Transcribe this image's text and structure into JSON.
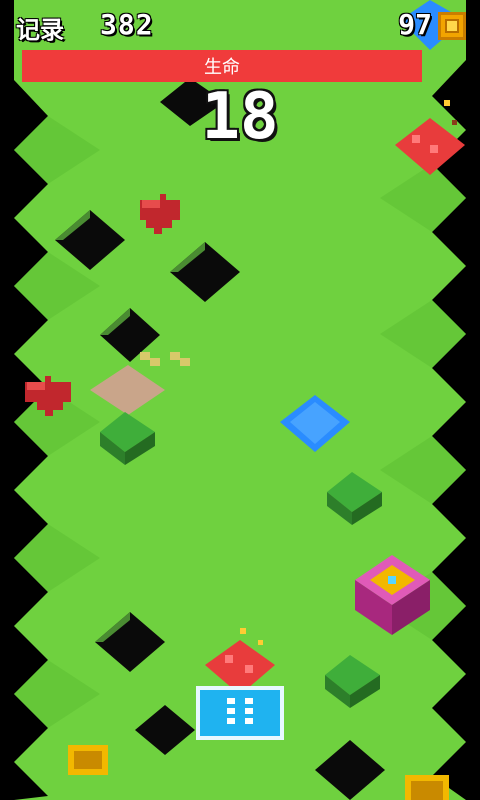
{
  "hud": {
    "record_label": "记录",
    "record_value": "382",
    "coins": "97",
    "coin_icon": "coin-icon",
    "life_label": "生命",
    "score": "18"
  },
  "controls": {
    "pause_icon": "pause-icon"
  },
  "colors": {
    "grass": "#6fd13f",
    "grass_dark": "#5cbf33",
    "side": "#3d7a2a",
    "life_bar": "#f03b3b",
    "pause": "#1fb3f0",
    "lava": "#e83c3c",
    "water": "#2a8cff",
    "tree": "#3fae3a",
    "chest": "#c9349c",
    "gold": "#f2b800"
  }
}
